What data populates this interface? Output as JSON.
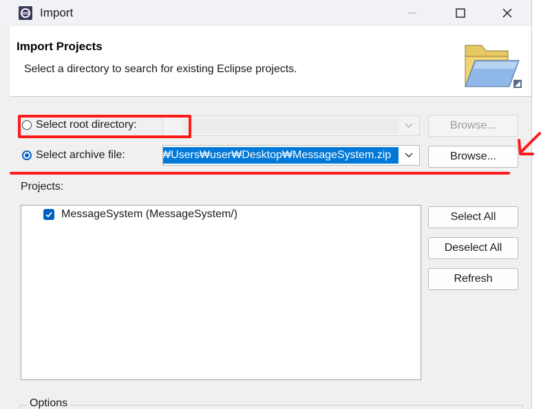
{
  "window": {
    "title": "Import"
  },
  "banner": {
    "title": "Import Projects",
    "description": "Select a directory to search for existing Eclipse projects."
  },
  "source": {
    "root_directory_label": "Select root directory:",
    "root_browse_label": "Browse...",
    "archive_label": "Select archive file:",
    "archive_value": "₩Users₩user₩Desktop₩MessageSystem.zip",
    "archive_browse_label": "Browse..."
  },
  "projects": {
    "label": "Projects:",
    "items": [
      {
        "label": "MessageSystem (MessageSystem/)",
        "checked": true
      }
    ],
    "select_all_label": "Select All",
    "deselect_all_label": "Deselect All",
    "refresh_label": "Refresh"
  },
  "options": {
    "label": "Options"
  },
  "colors": {
    "accent": "#0060c0",
    "selection": "#0078d7",
    "annotation": "#ff1a1a"
  }
}
